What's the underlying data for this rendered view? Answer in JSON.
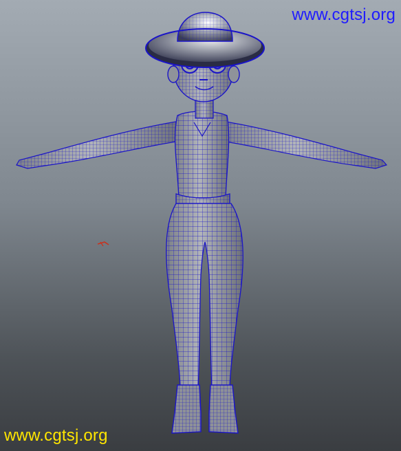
{
  "viewport": {
    "background_top": "#a3abb3",
    "background_bottom": "#3a3d41",
    "wire_color": "#1a14c8",
    "shade_color": "#9a9ea4"
  },
  "watermarks": {
    "top_text": "www.cgtsj.org",
    "top_color": "#1f1bff",
    "bottom_text": "www.cgtsj.org",
    "bottom_color": "#ffe600"
  },
  "scene": {
    "model": "t-pose-character-wireframe",
    "locator_icon": "axis-locator-icon",
    "locator_color": "#c8321e"
  }
}
